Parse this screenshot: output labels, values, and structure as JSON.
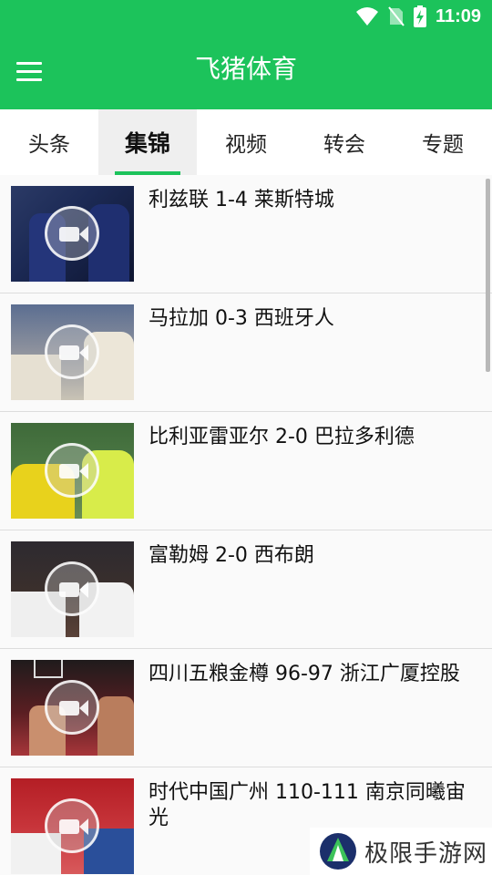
{
  "status": {
    "time": "11:09",
    "icons": [
      "wifi-icon",
      "no-sim-icon",
      "battery-charging-icon"
    ]
  },
  "header": {
    "title": "飞猪体育",
    "menu_icon": "menu-icon"
  },
  "tabs": [
    {
      "label": "头条",
      "active": false
    },
    {
      "label": "集锦",
      "active": true
    },
    {
      "label": "视频",
      "active": false
    },
    {
      "label": "转会",
      "active": false
    },
    {
      "label": "专题",
      "active": false
    }
  ],
  "items": [
    {
      "title": "利兹联 1-4 莱斯特城",
      "thumb_icon": "video-camera-icon"
    },
    {
      "title": "马拉加 0-3 西班牙人",
      "thumb_icon": "video-camera-icon"
    },
    {
      "title": "比利亚雷亚尔 2-0 巴拉多利德",
      "thumb_icon": "video-camera-icon"
    },
    {
      "title": "富勒姆 2-0 西布朗",
      "thumb_icon": "video-camera-icon"
    },
    {
      "title": "四川五粮金樽 96-97 浙江广厦控股",
      "thumb_icon": "video-camera-icon"
    },
    {
      "title": "时代中国广州 110-111 南京同曦宙光",
      "thumb_icon": "video-camera-icon"
    }
  ],
  "watermark": {
    "text": "极限手游网"
  },
  "colors": {
    "brand_green": "#1cc35b"
  }
}
